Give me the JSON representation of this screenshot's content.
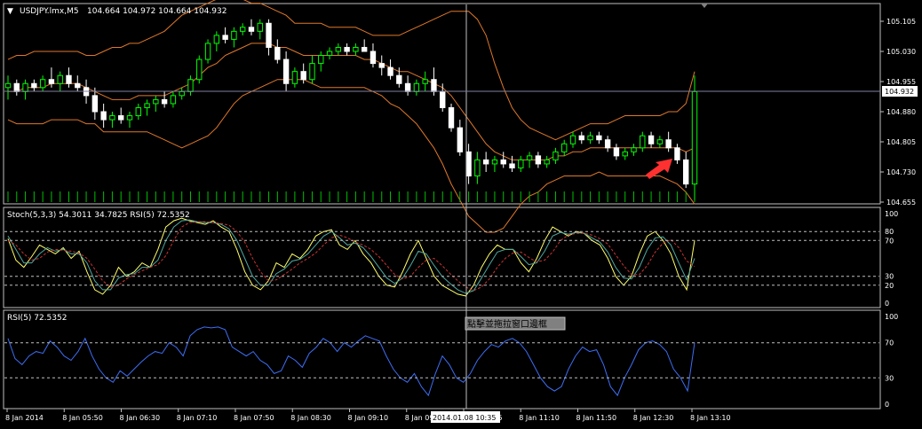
{
  "chart_data": {
    "type": "candlestick",
    "symbol_header": "USDJPY.lmx,M5",
    "ohlc_header": "104.664 104.972 104.664 104.932",
    "main_price_axis": {
      "ticks": [
        "105.105",
        "105.030",
        "104.955",
        "104.880",
        "104.805",
        "104.730",
        "104.655"
      ],
      "ylim": [
        104.655,
        105.105
      ],
      "current_price": "104.932"
    },
    "candles": [
      [
        104.94,
        104.97,
        104.91,
        104.95
      ],
      [
        104.95,
        104.96,
        104.92,
        104.93
      ],
      [
        104.93,
        104.96,
        104.91,
        104.95
      ],
      [
        104.95,
        104.96,
        104.93,
        104.94
      ],
      [
        104.94,
        104.97,
        104.93,
        104.96
      ],
      [
        104.96,
        104.99,
        104.94,
        104.95
      ],
      [
        104.95,
        104.98,
        104.93,
        104.97
      ],
      [
        104.97,
        104.99,
        104.94,
        104.95
      ],
      [
        104.95,
        104.97,
        104.93,
        104.94
      ],
      [
        104.94,
        104.96,
        104.9,
        104.92
      ],
      [
        104.92,
        104.94,
        104.86,
        104.88
      ],
      [
        104.88,
        104.9,
        104.84,
        104.86
      ],
      [
        104.86,
        104.88,
        104.84,
        104.87
      ],
      [
        104.87,
        104.89,
        104.85,
        104.86
      ],
      [
        104.86,
        104.88,
        104.84,
        104.87
      ],
      [
        104.87,
        104.9,
        104.86,
        104.89
      ],
      [
        104.89,
        104.91,
        104.87,
        104.9
      ],
      [
        104.9,
        104.92,
        104.88,
        104.91
      ],
      [
        104.91,
        104.93,
        104.89,
        104.9
      ],
      [
        104.9,
        104.93,
        104.89,
        104.92
      ],
      [
        104.92,
        104.94,
        104.91,
        104.93
      ],
      [
        104.93,
        104.97,
        104.92,
        104.96
      ],
      [
        104.96,
        105.02,
        104.95,
        105.01
      ],
      [
        105.01,
        105.06,
        105.0,
        105.05
      ],
      [
        105.05,
        105.08,
        105.03,
        105.07
      ],
      [
        105.07,
        105.09,
        105.05,
        105.06
      ],
      [
        105.06,
        105.09,
        105.04,
        105.08
      ],
      [
        105.08,
        105.1,
        105.07,
        105.09
      ],
      [
        105.09,
        105.11,
        105.07,
        105.08
      ],
      [
        105.08,
        105.11,
        105.06,
        105.1
      ],
      [
        105.1,
        105.11,
        105.02,
        105.04
      ],
      [
        105.04,
        105.06,
        105.0,
        105.01
      ],
      [
        105.01,
        105.03,
        104.93,
        104.95
      ],
      [
        104.95,
        104.99,
        104.94,
        104.98
      ],
      [
        104.98,
        105.0,
        104.95,
        104.96
      ],
      [
        104.96,
        105.02,
        104.95,
        105.0
      ],
      [
        105.0,
        105.03,
        104.98,
        105.02
      ],
      [
        105.02,
        105.04,
        105.01,
        105.03
      ],
      [
        105.03,
        105.05,
        105.02,
        105.04
      ],
      [
        105.04,
        105.05,
        105.02,
        105.03
      ],
      [
        105.03,
        105.05,
        105.02,
        105.04
      ],
      [
        105.04,
        105.06,
        105.03,
        105.03
      ],
      [
        105.03,
        105.05,
        104.99,
        105.0
      ],
      [
        105.0,
        105.02,
        104.97,
        104.99
      ],
      [
        104.99,
        105.01,
        104.96,
        104.97
      ],
      [
        104.97,
        104.99,
        104.94,
        104.95
      ],
      [
        104.95,
        104.97,
        104.92,
        104.93
      ],
      [
        104.93,
        104.96,
        104.92,
        104.95
      ],
      [
        104.95,
        104.98,
        104.93,
        104.96
      ],
      [
        104.96,
        104.99,
        104.92,
        104.93
      ],
      [
        104.93,
        104.95,
        104.88,
        104.89
      ],
      [
        104.89,
        104.9,
        104.83,
        104.84
      ],
      [
        104.84,
        104.86,
        104.77,
        104.78
      ],
      [
        104.78,
        104.8,
        104.7,
        104.72
      ],
      [
        104.72,
        104.78,
        104.7,
        104.76
      ],
      [
        104.76,
        104.78,
        104.73,
        104.75
      ],
      [
        104.75,
        104.77,
        104.73,
        104.76
      ],
      [
        104.76,
        104.78,
        104.74,
        104.75
      ],
      [
        104.75,
        104.77,
        104.73,
        104.74
      ],
      [
        104.74,
        104.77,
        104.73,
        104.76
      ],
      [
        104.76,
        104.78,
        104.74,
        104.77
      ],
      [
        104.77,
        104.78,
        104.74,
        104.75
      ],
      [
        104.75,
        104.77,
        104.74,
        104.76
      ],
      [
        104.76,
        104.79,
        104.75,
        104.78
      ],
      [
        104.78,
        104.81,
        104.77,
        104.8
      ],
      [
        104.8,
        104.83,
        104.79,
        104.82
      ],
      [
        104.82,
        104.83,
        104.8,
        104.81
      ],
      [
        104.81,
        104.83,
        104.8,
        104.82
      ],
      [
        104.82,
        104.83,
        104.8,
        104.81
      ],
      [
        104.81,
        104.82,
        104.78,
        104.79
      ],
      [
        104.79,
        104.8,
        104.76,
        104.77
      ],
      [
        104.77,
        104.79,
        104.76,
        104.78
      ],
      [
        104.78,
        104.8,
        104.77,
        104.79
      ],
      [
        104.79,
        104.83,
        104.78,
        104.82
      ],
      [
        104.82,
        104.83,
        104.79,
        104.8
      ],
      [
        104.8,
        104.82,
        104.79,
        104.81
      ],
      [
        104.81,
        104.83,
        104.78,
        104.79
      ],
      [
        104.79,
        104.8,
        104.75,
        104.76
      ],
      [
        104.76,
        104.78,
        104.69,
        104.7
      ],
      [
        104.7,
        104.97,
        104.66,
        104.93
      ]
    ],
    "indicators": [
      {
        "name": "Bollinger upper",
        "color": "#e0782a",
        "values": [
          105.01,
          105.02,
          105.02,
          105.03,
          105.03,
          105.03,
          105.03,
          105.03,
          105.03,
          105.02,
          105.02,
          105.03,
          105.04,
          105.04,
          105.05,
          105.05,
          105.06,
          105.07,
          105.08,
          105.1,
          105.12,
          105.13,
          105.14,
          105.15,
          105.16,
          105.16,
          105.16,
          105.16,
          105.15,
          105.15,
          105.14,
          105.13,
          105.12,
          105.1,
          105.1,
          105.1,
          105.1,
          105.09,
          105.09,
          105.09,
          105.09,
          105.08,
          105.07,
          105.07,
          105.07,
          105.07,
          105.08,
          105.09,
          105.1,
          105.11,
          105.12,
          105.13,
          105.13,
          105.13,
          105.11,
          105.07,
          105.0,
          104.94,
          104.89,
          104.86,
          104.84,
          104.83,
          104.82,
          104.81,
          104.82,
          104.83,
          104.84,
          104.85,
          104.85,
          104.85,
          104.86,
          104.87,
          104.87,
          104.87,
          104.87,
          104.87,
          104.88,
          104.88,
          104.9,
          104.98
        ]
      },
      {
        "name": "Bollinger middle",
        "color": "#e0782a",
        "values": [
          104.93,
          104.93,
          104.94,
          104.94,
          104.94,
          104.95,
          104.95,
          104.95,
          104.95,
          104.94,
          104.93,
          104.92,
          104.91,
          104.91,
          104.91,
          104.92,
          104.92,
          104.92,
          104.92,
          104.93,
          104.94,
          104.95,
          104.97,
          104.99,
          105.0,
          105.02,
          105.03,
          105.04,
          105.05,
          105.05,
          105.05,
          105.04,
          105.04,
          105.03,
          105.02,
          105.02,
          105.02,
          105.02,
          105.02,
          105.02,
          105.02,
          105.01,
          105.01,
          105.0,
          104.99,
          104.98,
          104.98,
          104.97,
          104.96,
          104.95,
          104.94,
          104.92,
          104.89,
          104.86,
          104.83,
          104.8,
          104.78,
          104.77,
          104.76,
          104.76,
          104.76,
          104.76,
          104.76,
          104.77,
          104.77,
          104.78,
          104.78,
          104.79,
          104.79,
          104.79,
          104.79,
          104.79,
          104.79,
          104.79,
          104.79,
          104.79,
          104.79,
          104.79,
          104.78,
          104.79
        ]
      },
      {
        "name": "Bollinger lower",
        "color": "#e0782a",
        "values": [
          104.86,
          104.85,
          104.85,
          104.85,
          104.85,
          104.86,
          104.86,
          104.86,
          104.86,
          104.85,
          104.85,
          104.83,
          104.83,
          104.83,
          104.83,
          104.83,
          104.83,
          104.82,
          104.81,
          104.8,
          104.79,
          104.8,
          104.81,
          104.82,
          104.84,
          104.87,
          104.9,
          104.92,
          104.93,
          104.94,
          104.95,
          104.96,
          104.96,
          104.96,
          104.96,
          104.95,
          104.94,
          104.94,
          104.94,
          104.94,
          104.94,
          104.94,
          104.93,
          104.92,
          104.9,
          104.89,
          104.87,
          104.85,
          104.82,
          104.79,
          104.75,
          104.7,
          104.66,
          104.62,
          104.6,
          104.58,
          104.58,
          104.59,
          104.62,
          104.65,
          104.67,
          104.68,
          104.7,
          104.71,
          104.72,
          104.72,
          104.72,
          104.72,
          104.73,
          104.72,
          104.72,
          104.72,
          104.72,
          104.72,
          104.72,
          104.72,
          104.71,
          104.7,
          104.68,
          104.65
        ]
      }
    ],
    "volumes": [
      4,
      4,
      4,
      4,
      4,
      4,
      4,
      4,
      4,
      4,
      4,
      4,
      4,
      4,
      4,
      4,
      4,
      4,
      4,
      4,
      4,
      4,
      4,
      4,
      4,
      4,
      4,
      4,
      4,
      4,
      4,
      4,
      4,
      4,
      4,
      4,
      4,
      4,
      4,
      4,
      4,
      4,
      4,
      4,
      4,
      4,
      4,
      4,
      4,
      4,
      4,
      4,
      4,
      4,
      4,
      4,
      4,
      4,
      4,
      4,
      4,
      4,
      4,
      4,
      4,
      4,
      4,
      4,
      4,
      4,
      4,
      4,
      4,
      4,
      4,
      4,
      4,
      4,
      4,
      4
    ],
    "stoch_panel": {
      "label": "Stoch(5,3,3) 54.3011 34.7825  RSI(5) 72.5352",
      "ylim": [
        0,
        100
      ],
      "ticks": [
        "100",
        "80",
        "70",
        "30",
        "20",
        "0"
      ],
      "levels": [
        80,
        70,
        30,
        20
      ],
      "series": [
        {
          "color": "#ffff66",
          "values": [
            72,
            48,
            40,
            52,
            65,
            60,
            55,
            62,
            50,
            58,
            35,
            15,
            10,
            20,
            40,
            30,
            35,
            45,
            40,
            60,
            85,
            92,
            95,
            92,
            90,
            88,
            92,
            85,
            80,
            60,
            35,
            20,
            15,
            25,
            45,
            40,
            55,
            50,
            60,
            75,
            80,
            82,
            65,
            60,
            70,
            55,
            45,
            30,
            20,
            18,
            35,
            55,
            70,
            50,
            30,
            20,
            15,
            10,
            8,
            20,
            40,
            55,
            65,
            60,
            60,
            45,
            35,
            50,
            70,
            85,
            80,
            75,
            80,
            78,
            70,
            65,
            50,
            30,
            20,
            30,
            55,
            75,
            80,
            70,
            55,
            30,
            15,
            70
          ]
        },
        {
          "color": "#4fa8a0",
          "values": [
            75,
            60,
            45,
            45,
            55,
            62,
            58,
            60,
            55,
            55,
            45,
            25,
            15,
            15,
            28,
            32,
            33,
            40,
            40,
            48,
            70,
            85,
            92,
            93,
            91,
            90,
            90,
            88,
            83,
            70,
            50,
            30,
            20,
            20,
            33,
            38,
            47,
            49,
            55,
            65,
            75,
            80,
            73,
            65,
            67,
            62,
            52,
            40,
            28,
            22,
            28,
            42,
            58,
            55,
            42,
            30,
            22,
            15,
            11,
            14,
            28,
            43,
            57,
            60,
            60,
            52,
            43,
            45,
            58,
            75,
            79,
            77,
            79,
            78,
            73,
            68,
            57,
            40,
            28,
            27,
            40,
            60,
            73,
            74,
            65,
            45,
            26,
            50
          ]
        },
        {
          "color": "#cc3333",
          "dash": true,
          "values": [
            70,
            65,
            55,
            48,
            50,
            57,
            60,
            59,
            58,
            56,
            50,
            38,
            25,
            18,
            20,
            27,
            32,
            36,
            40,
            43,
            53,
            70,
            85,
            90,
            91,
            91,
            90,
            89,
            87,
            80,
            68,
            50,
            35,
            25,
            26,
            32,
            38,
            45,
            50,
            56,
            65,
            73,
            76,
            73,
            68,
            65,
            60,
            52,
            42,
            32,
            27,
            30,
            40,
            48,
            50,
            42,
            33,
            25,
            18,
            14,
            18,
            27,
            40,
            50,
            56,
            57,
            51,
            46,
            48,
            57,
            70,
            76,
            78,
            78,
            76,
            72,
            66,
            54,
            42,
            32,
            32,
            42,
            57,
            67,
            71,
            62,
            47,
            41
          ]
        }
      ]
    },
    "rsi_panel": {
      "label": "RSI(5) 72.5352",
      "ylim": [
        0,
        100
      ],
      "ticks": [
        "100",
        "70",
        "30",
        "0"
      ],
      "levels": [
        70,
        30
      ],
      "series": [
        {
          "color": "#3d6ef5",
          "values": [
            75,
            52,
            45,
            55,
            60,
            58,
            72,
            65,
            55,
            50,
            60,
            75,
            55,
            40,
            30,
            25,
            38,
            32,
            40,
            48,
            55,
            60,
            58,
            70,
            65,
            55,
            78,
            85,
            88,
            87,
            88,
            85,
            65,
            60,
            55,
            60,
            50,
            45,
            35,
            38,
            55,
            50,
            42,
            58,
            65,
            75,
            70,
            60,
            70,
            65,
            72,
            78,
            75,
            72,
            55,
            40,
            30,
            25,
            35,
            20,
            10,
            35,
            55,
            45,
            30,
            25,
            35,
            50,
            60,
            68,
            65,
            72,
            75,
            70,
            60,
            45,
            30,
            20,
            15,
            20,
            40,
            55,
            65,
            60,
            62,
            45,
            20,
            10,
            30,
            45,
            62,
            70,
            72,
            68,
            60,
            40,
            30,
            15,
            70
          ]
        }
      ]
    },
    "x_axis": {
      "ticks": [
        "8 Jan 2014",
        "8 Jan 05:50",
        "8 Jan 06:30",
        "8 Jan 07:10",
        "8 Jan 07:50",
        "8 Jan 08:30",
        "8 Jan 09:10",
        "8 Jan 09:50",
        "8 Jan 10:35",
        "8 Jan 11:10",
        "8 Jan 11:50",
        "8 Jan 12:30",
        "8 Jan 13:10"
      ],
      "crosshair_time": "2014.01.08  10:35"
    },
    "tooltip": "點擊並拖拉窗口邊框",
    "colors": {
      "bull": "#00ff00",
      "bear": "#ffffff",
      "grid": "#c0c0c0",
      "arrow": "#ff3030"
    }
  }
}
